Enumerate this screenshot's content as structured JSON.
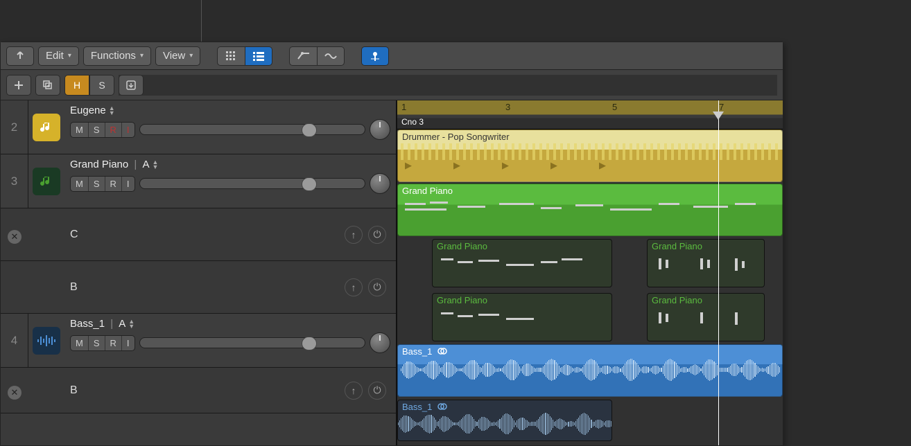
{
  "toolbar": {
    "edit": "Edit",
    "functions": "Functions",
    "view": "View"
  },
  "subheader": {
    "h": "H",
    "s": "S"
  },
  "labels": {
    "m": "M",
    "s": "S",
    "r": "R",
    "i": "I"
  },
  "ruler": {
    "marks": [
      "1",
      "3",
      "5",
      "7"
    ],
    "marker": "Cno 3"
  },
  "tracks": [
    {
      "num": "2",
      "name": "Eugene"
    },
    {
      "num": "3",
      "name": "Grand Piano",
      "take": "A",
      "takes": [
        "C",
        "B"
      ]
    },
    {
      "num": "4",
      "name": "Bass_1",
      "take": "A",
      "takes": [
        "B"
      ]
    }
  ],
  "regions": {
    "drummer": "Drummer - Pop Songwriter",
    "piano": "Grand Piano",
    "bass": "Bass_1"
  }
}
